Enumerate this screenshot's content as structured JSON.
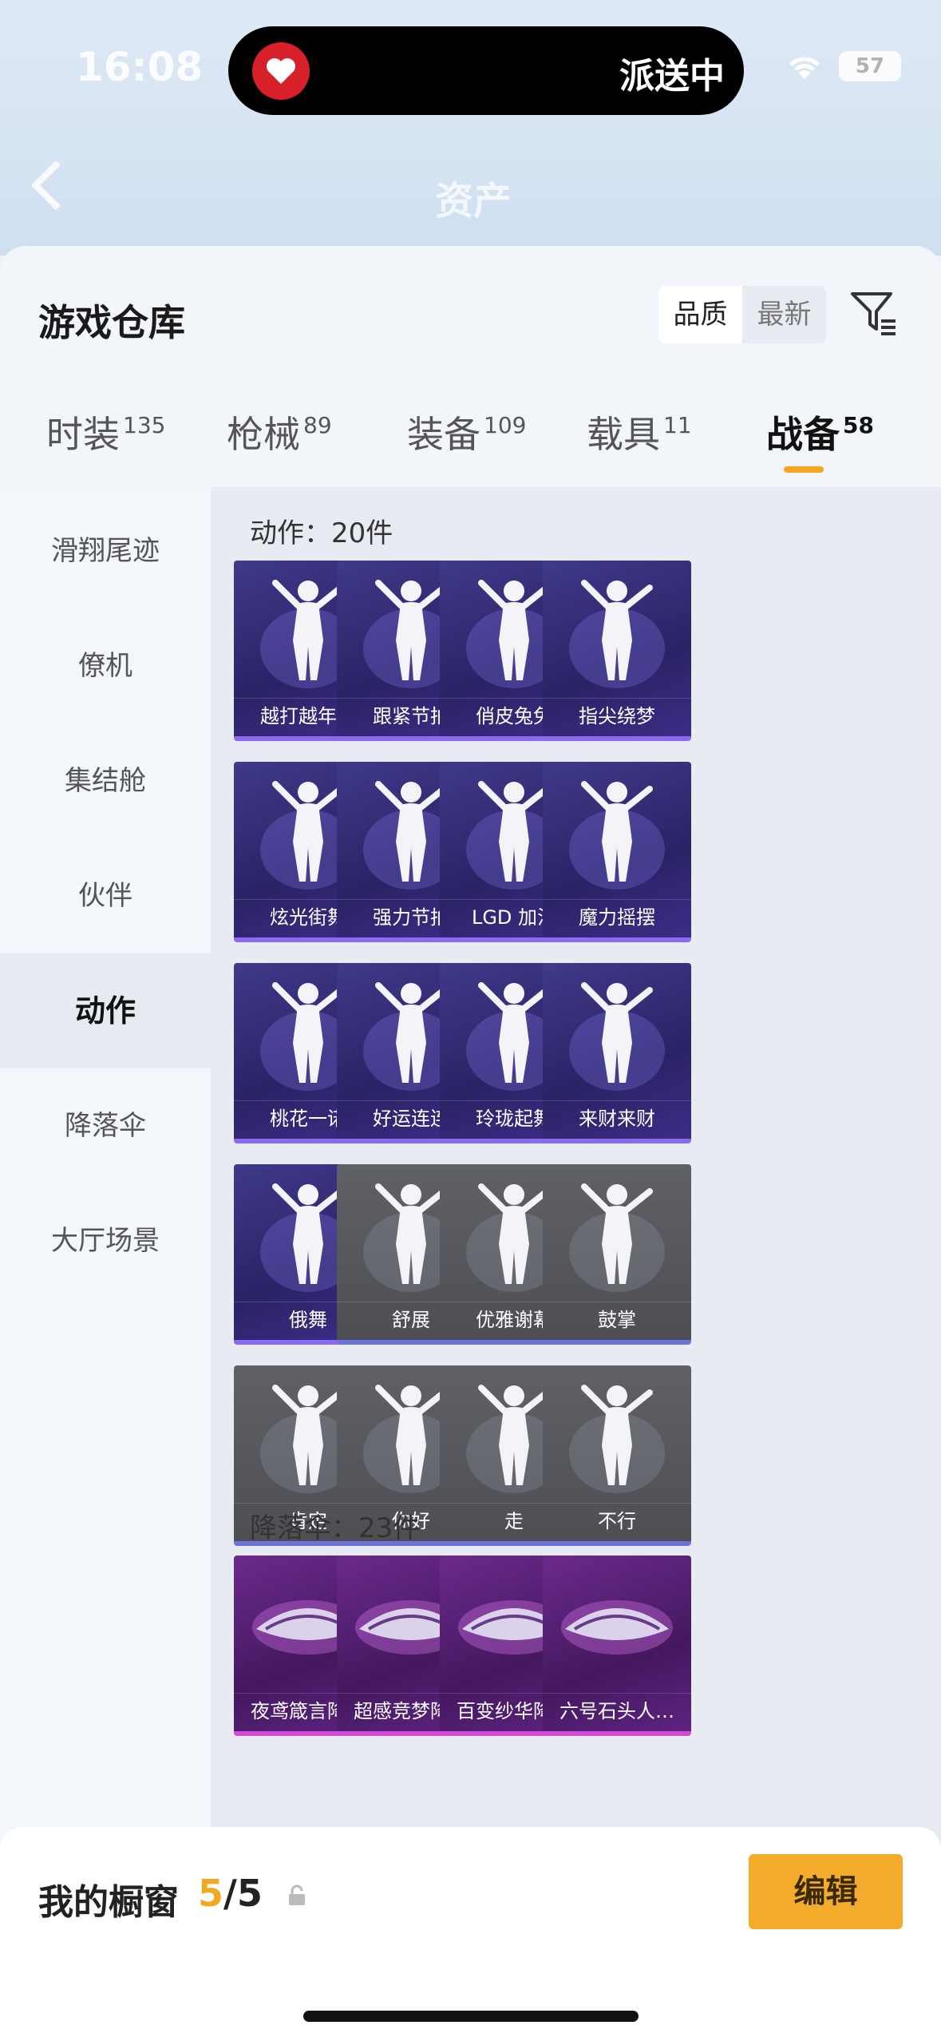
{
  "status_bar": {
    "time": "16:08",
    "battery": "57",
    "island_text": "派送中"
  },
  "header": {
    "title": "资产"
  },
  "sheet": {
    "title": "游戏仓库",
    "sort_options": [
      "品质",
      "最新"
    ],
    "sort_selected": "品质"
  },
  "tabs": [
    {
      "label": "时装",
      "count": "135"
    },
    {
      "label": "枪械",
      "count": "89"
    },
    {
      "label": "装备",
      "count": "109"
    },
    {
      "label": "载具",
      "count": "11"
    },
    {
      "label": "战备",
      "count": "58",
      "active": true
    }
  ],
  "sidebar": [
    {
      "label": "滑翔尾迹"
    },
    {
      "label": "僚机"
    },
    {
      "label": "集结舱"
    },
    {
      "label": "伙伴"
    },
    {
      "label": "动作",
      "active": true
    },
    {
      "label": "降落伞"
    },
    {
      "label": "大厅场景"
    }
  ],
  "sections": {
    "actions": {
      "title": "动作：20件",
      "items": [
        {
          "name": "越打越年轻",
          "style": "purple",
          "icon": "dancer-icon"
        },
        {
          "name": "跟紧节拍",
          "style": "purple",
          "icon": "dancer-icon"
        },
        {
          "name": "俏皮兔兔",
          "style": "purple",
          "icon": "dancer-icon"
        },
        {
          "name": "指尖绕梦",
          "style": "purple",
          "icon": "dancer-icon"
        },
        {
          "name": "炫光街舞",
          "style": "purple",
          "icon": "dancer-icon"
        },
        {
          "name": "强力节拍",
          "style": "purple",
          "icon": "dancer-icon"
        },
        {
          "name": "LGD 加油",
          "style": "purple",
          "icon": "dancer-icon"
        },
        {
          "name": "魔力摇摆",
          "style": "purple",
          "icon": "dancer-icon"
        },
        {
          "name": "桃花一诺",
          "style": "purple",
          "icon": "dancer-icon"
        },
        {
          "name": "好运连连",
          "style": "purple",
          "icon": "dancer-icon"
        },
        {
          "name": "玲珑起舞",
          "style": "purple",
          "icon": "dancer-icon"
        },
        {
          "name": "来财来财",
          "style": "purple",
          "icon": "dancer-icon"
        },
        {
          "name": "俄舞",
          "style": "purple",
          "icon": "dancer-icon"
        },
        {
          "name": "舒展",
          "style": "gray",
          "icon": "stretch-icon"
        },
        {
          "name": "优雅谢幕",
          "style": "gray",
          "icon": "bow-icon"
        },
        {
          "name": "鼓掌",
          "style": "gray",
          "icon": "clap-icon"
        },
        {
          "name": "肯定",
          "style": "gray",
          "icon": "nod-icon"
        },
        {
          "name": "你好",
          "style": "gray",
          "icon": "wave-icon"
        },
        {
          "name": "走",
          "style": "gray",
          "icon": "point-icon"
        },
        {
          "name": "不行",
          "style": "gray",
          "icon": "shake-head-icon"
        }
      ]
    },
    "parachutes": {
      "title": "降落伞：23件",
      "items": [
        {
          "name": "夜鸢箴言降…",
          "style": "magenta",
          "icon": "parachute-icon"
        },
        {
          "name": "超感竞梦降…",
          "style": "magenta",
          "icon": "parachute-icon"
        },
        {
          "name": "百变纱华降…",
          "style": "magenta",
          "icon": "parachute-icon"
        },
        {
          "name": "六号石头人…",
          "style": "magenta",
          "icon": "parachute-icon"
        }
      ]
    }
  },
  "bottom_bar": {
    "label": "我的橱窗",
    "current": "5",
    "total": "/5",
    "edit_label": "编辑"
  }
}
